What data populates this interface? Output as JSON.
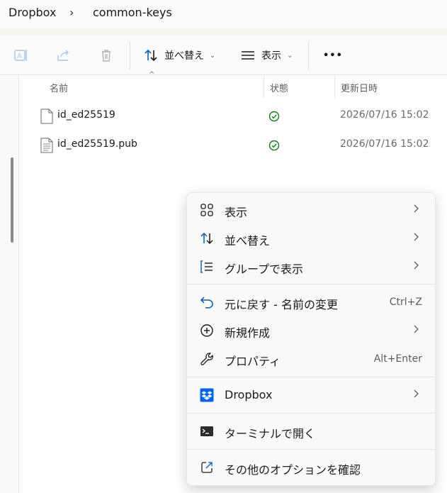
{
  "breadcrumb": {
    "root": "Dropbox",
    "current": "common-keys",
    "separator": "›"
  },
  "toolbar": {
    "sort_label": "並べ替え",
    "view_label": "表示",
    "caret": "⌄",
    "more": "•••"
  },
  "columns": {
    "name": "名前",
    "status": "状態",
    "modified": "更新日時",
    "sort_caret": "^"
  },
  "files": [
    {
      "name": "id_ed25519",
      "modified": "2026/07/16 15:02",
      "status": "synced"
    },
    {
      "name": "id_ed25519.pub",
      "modified": "2026/07/16 15:02",
      "status": "synced"
    }
  ],
  "context_menu": {
    "view": "表示",
    "sort": "並べ替え",
    "group": "グループで表示",
    "undo": "元に戻す - 名前の変更",
    "undo_shortcut": "Ctrl+Z",
    "new": "新規作成",
    "properties": "プロパティ",
    "properties_shortcut": "Alt+Enter",
    "dropbox": "Dropbox",
    "terminal": "ターミナルで開く",
    "more_options": "その他のオプションを確認"
  },
  "colors": {
    "accent": "#005fb8",
    "synced": "#107c10",
    "dropbox": "#0061fe"
  }
}
